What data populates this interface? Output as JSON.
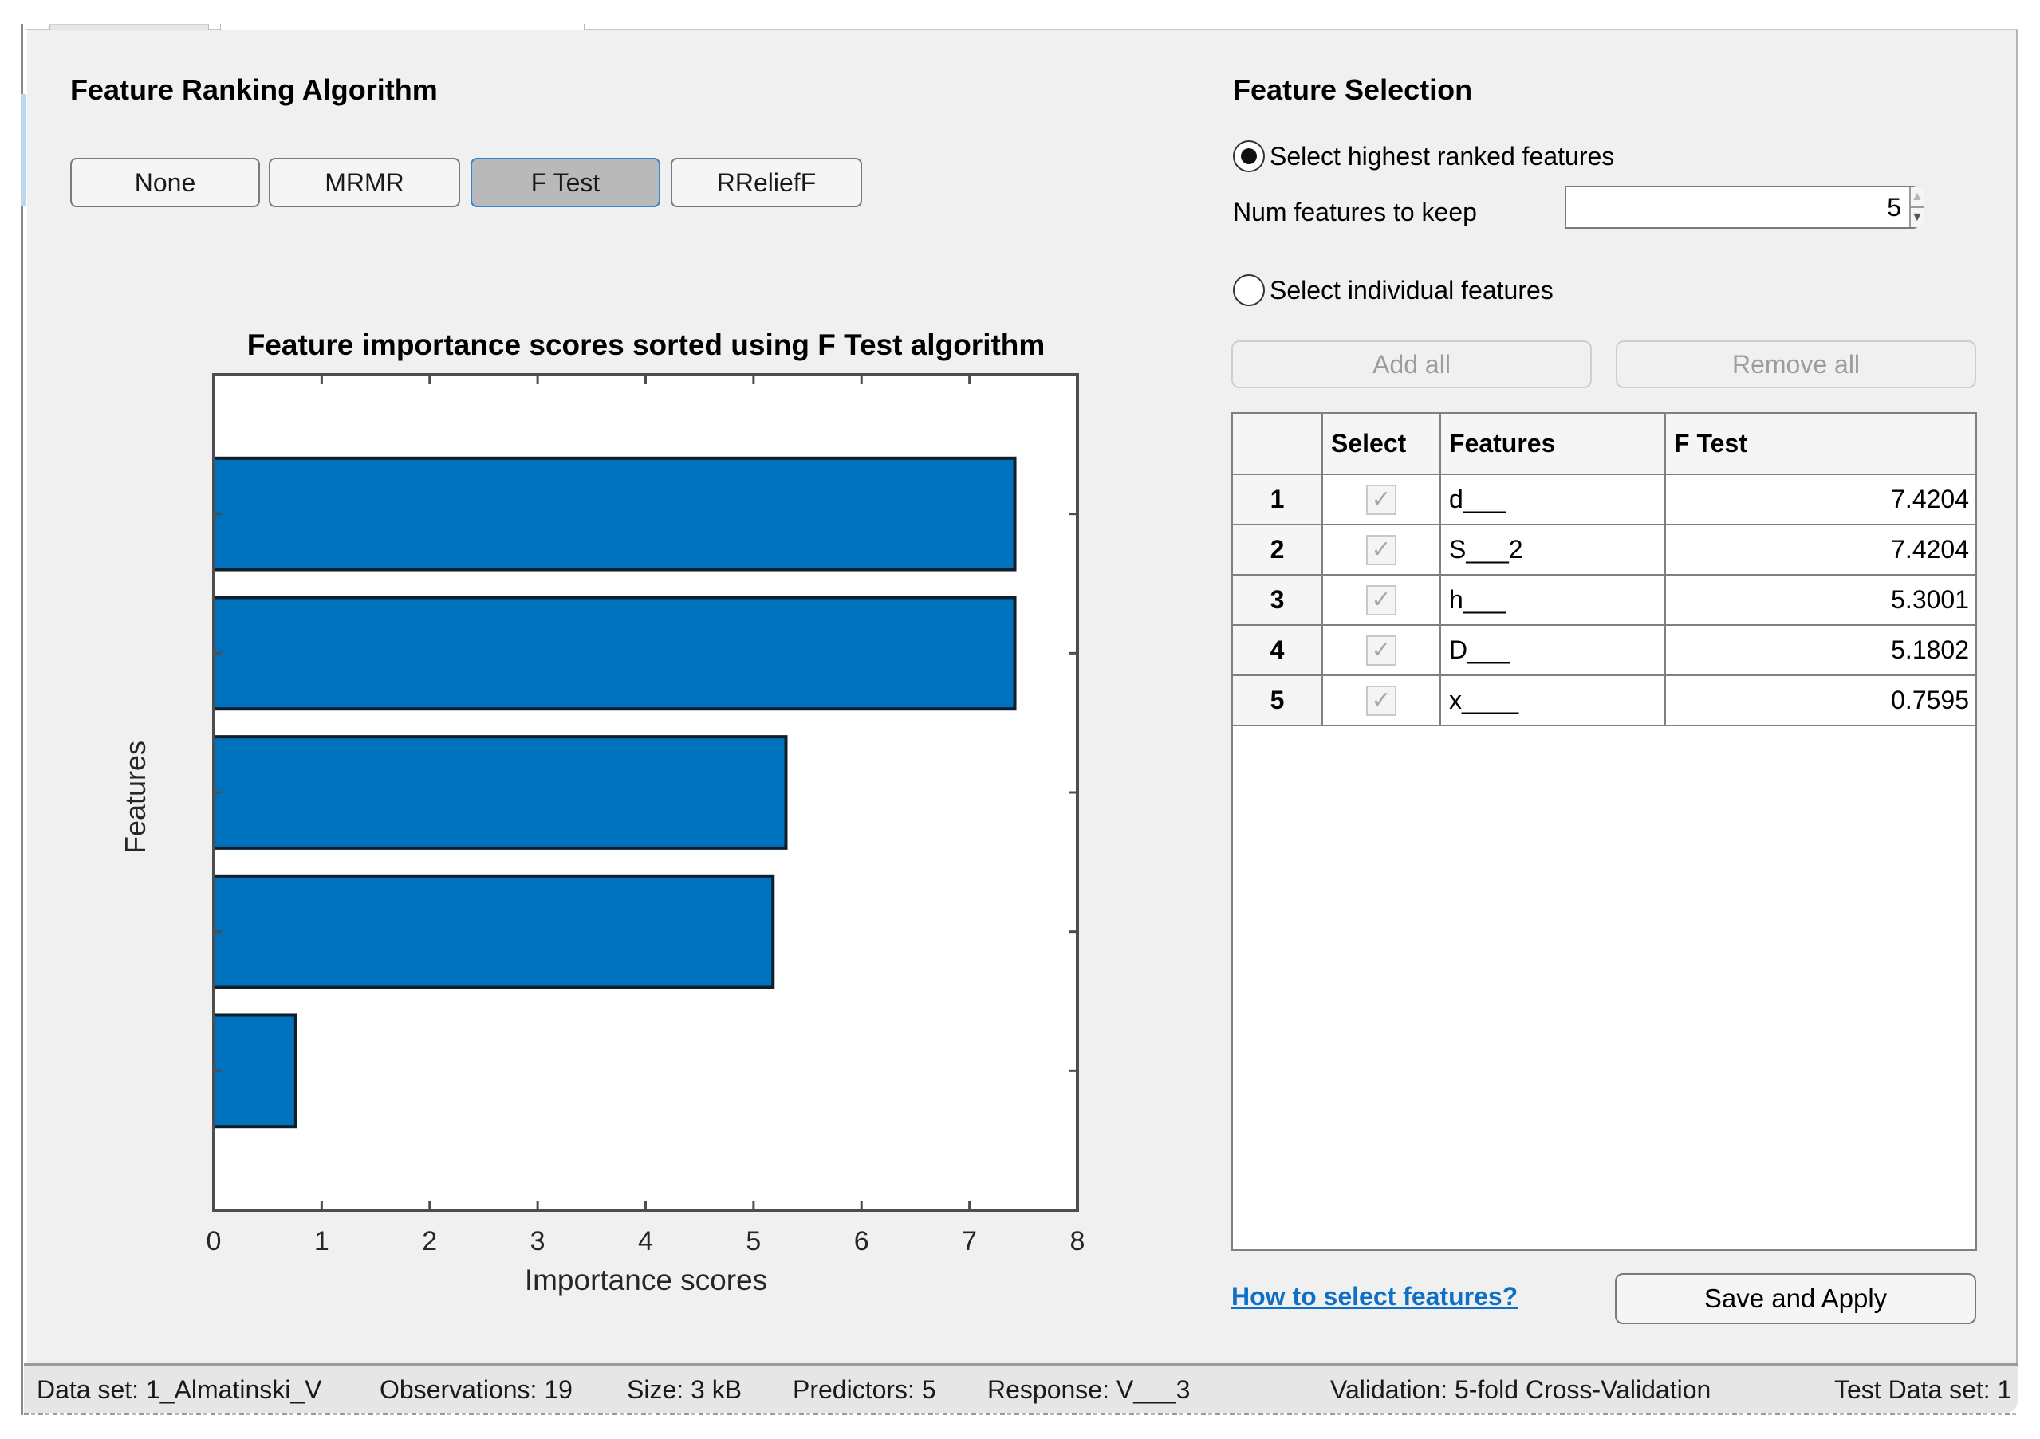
{
  "algorithm_section": {
    "title": "Feature Ranking Algorithm",
    "buttons": [
      {
        "label": "None",
        "active": false
      },
      {
        "label": "MRMR",
        "active": false
      },
      {
        "label": "F Test",
        "active": true
      },
      {
        "label": "RReliefF",
        "active": false
      }
    ]
  },
  "chart_data": {
    "type": "bar",
    "orientation": "horizontal",
    "title": "Feature importance scores sorted using F Test algorithm",
    "xlabel": "Importance scores",
    "ylabel": "Features",
    "categories": [
      "d___",
      "S___2",
      "h___",
      "D___",
      "x____"
    ],
    "values": [
      7.4204,
      7.4204,
      5.3001,
      5.1802,
      0.7595
    ],
    "xlim": [
      0,
      8
    ],
    "ylim": [
      0,
      6
    ],
    "xticks": [
      "0",
      "1",
      "2",
      "3",
      "4",
      "5",
      "6",
      "7",
      "8"
    ],
    "bar_color": "#0072BD",
    "grid": false
  },
  "selection_section": {
    "title": "Feature Selection",
    "radio_highest": {
      "label": "Select highest ranked features",
      "selected": true
    },
    "num_features_label": "Num features to keep",
    "num_features_value": "5",
    "radio_individual": {
      "label": "Select individual features",
      "selected": false
    },
    "add_all_label": "Add all",
    "remove_all_label": "Remove all"
  },
  "table": {
    "columns": [
      "",
      "Select",
      "Features",
      "F Test"
    ],
    "rows": [
      {
        "rank": "1",
        "selected": true,
        "feature": "d___",
        "score": "7.4204"
      },
      {
        "rank": "2",
        "selected": true,
        "feature": "S___2",
        "score": "7.4204"
      },
      {
        "rank": "3",
        "selected": true,
        "feature": "h___",
        "score": "5.3001"
      },
      {
        "rank": "4",
        "selected": true,
        "feature": "D___",
        "score": "5.1802"
      },
      {
        "rank": "5",
        "selected": true,
        "feature": "x____",
        "score": "0.7595"
      }
    ]
  },
  "help_link": "How to select features?",
  "save_button": "Save and Apply",
  "status_bar": {
    "data_set": "Data set: 1_Almatinski_V",
    "observations": "Observations: 19",
    "size": "Size: 3 kB",
    "predictors": "Predictors: 5",
    "response": "Response: V___3",
    "validation": "Validation: 5-fold Cross-Validation",
    "test_data_set": "Test Data set: 1"
  },
  "colors": {
    "bar": "#0072BD",
    "active_button_bg": "#B9B9B9",
    "active_button_border": "#2F86D9",
    "link": "#0E6FC6",
    "panel_bg": "#F0F0F0"
  }
}
